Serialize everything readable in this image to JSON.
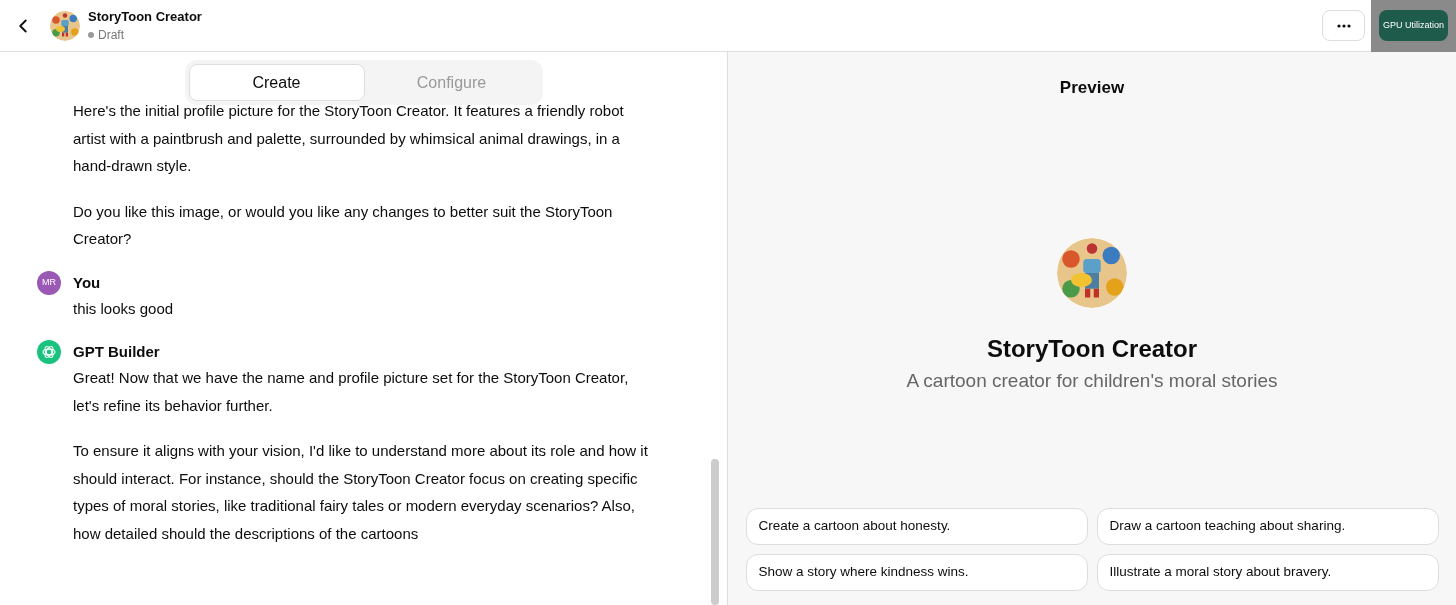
{
  "header": {
    "title": "StoryToon Creator",
    "status": "Draft",
    "overlay_button": "GPU Utilization"
  },
  "tabs": [
    {
      "label": "Create",
      "selected": true
    },
    {
      "label": "Configure",
      "selected": false
    }
  ],
  "messages": [
    {
      "paragraphs": [
        "Here's the initial profile picture for the StoryToon Creator. It features a friendly robot artist with a paintbrush and palette, surrounded by whimsical animal drawings, in a hand-drawn style.",
        "Do you like this image, or would you like any changes to better suit the StoryToon Creator?"
      ]
    },
    {
      "author": "You",
      "kind": "user",
      "initials": "MR",
      "paragraphs": [
        "this looks good"
      ]
    },
    {
      "author": "GPT Builder",
      "kind": "bot",
      "paragraphs": [
        "Great! Now that we have the name and profile picture set for the StoryToon Creator, let's refine its behavior further.",
        "To ensure it aligns with your vision, I'd like to understand more about its role and how it should interact. For instance, should the StoryToon Creator focus on creating specific types of moral stories, like traditional fairy tales or modern everyday scenarios? Also, how detailed should the descriptions of the cartoons"
      ]
    }
  ],
  "preview": {
    "title": "Preview",
    "name": "StoryToon Creator",
    "description": "A cartoon creator for children's moral stories",
    "suggestions": [
      "Create a cartoon about honesty.",
      "Draw a cartoon teaching about sharing.",
      "Show a story where kindness wins.",
      "Illustrate a moral story about bravery."
    ]
  }
}
